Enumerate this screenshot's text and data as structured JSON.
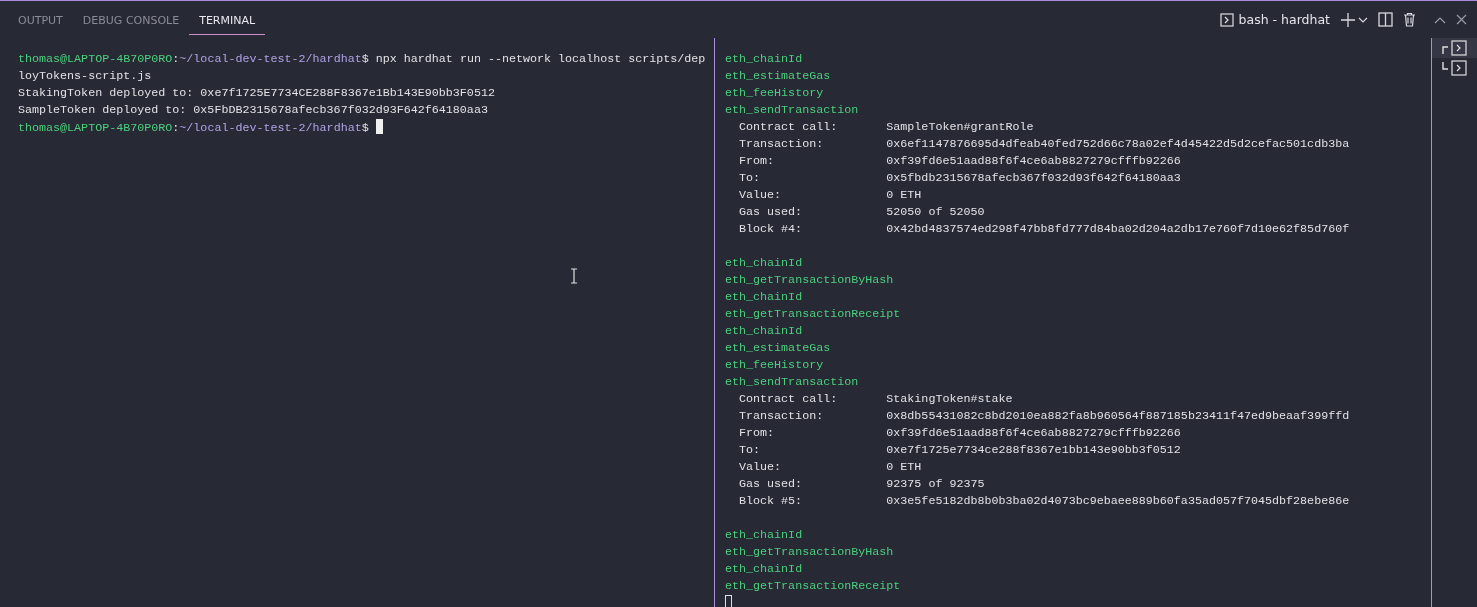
{
  "panel_tabs": [
    {
      "label": "OUTPUT",
      "selected": false
    },
    {
      "label": "DEBUG CONSOLE",
      "selected": false
    },
    {
      "label": "TERMINAL",
      "selected": true
    }
  ],
  "terminal_title": "bash - hardhat",
  "terminal_list": [
    {
      "selected": true
    },
    {
      "selected": false
    }
  ],
  "left_pane": {
    "prompts": [
      {
        "user": "thomas@LAPTOP-4B70P0RO",
        "separator": ":",
        "path": "~/local-dev-test-2/hardhat",
        "sigil": "$"
      },
      {
        "user": "thomas@LAPTOP-4B70P0RO",
        "separator": ":",
        "path": "~/local-dev-test-2/hardhat",
        "sigil": "$"
      }
    ],
    "command": "npx hardhat run --network localhost scripts/deployTokens-script.js",
    "output": [
      "StakingToken deployed to: 0xe7f1725E7734CE288F8367e1Bb143E90bb3F0512",
      "SampleToken deployed to: 0x5FbDB2315678afecb367f032d93F642f64180aa3"
    ],
    "cursor_focused": true
  },
  "right_pane": {
    "log": [
      {
        "kind": "method",
        "text": "eth_chainId"
      },
      {
        "kind": "method",
        "text": "eth_estimateGas"
      },
      {
        "kind": "method",
        "text": "eth_feeHistory"
      },
      {
        "kind": "method",
        "text": "eth_sendTransaction"
      },
      {
        "kind": "field",
        "label": "Contract call:",
        "value": "SampleToken#grantRole"
      },
      {
        "kind": "field",
        "label": "Transaction:",
        "value": "0x6ef1147876695d4dfeab40fed752d66c78a02ef4d45422d5d2cefac501cdb3ba"
      },
      {
        "kind": "field",
        "label": "From:",
        "value": "0xf39fd6e51aad88f6f4ce6ab8827279cfffb92266"
      },
      {
        "kind": "field",
        "label": "To:",
        "value": "0x5fbdb2315678afecb367f032d93f642f64180aa3"
      },
      {
        "kind": "field",
        "label": "Value:",
        "value": "0 ETH"
      },
      {
        "kind": "field",
        "label": "Gas used:",
        "value": "52050 of 52050"
      },
      {
        "kind": "field",
        "label": "Block #4:",
        "value": "0x42bd4837574ed298f47bb8fd777d84ba02d204a2db17e760f7d10e62f85d760f"
      },
      {
        "kind": "gap"
      },
      {
        "kind": "method",
        "text": "eth_chainId"
      },
      {
        "kind": "method",
        "text": "eth_getTransactionByHash"
      },
      {
        "kind": "method",
        "text": "eth_chainId"
      },
      {
        "kind": "method",
        "text": "eth_getTransactionReceipt"
      },
      {
        "kind": "method",
        "text": "eth_chainId"
      },
      {
        "kind": "method",
        "text": "eth_estimateGas"
      },
      {
        "kind": "method",
        "text": "eth_feeHistory"
      },
      {
        "kind": "method",
        "text": "eth_sendTransaction"
      },
      {
        "kind": "field",
        "label": "Contract call:",
        "value": "StakingToken#stake"
      },
      {
        "kind": "field",
        "label": "Transaction:",
        "value": "0x8db55431082c8bd2010ea882fa8b960564f887185b23411f47ed9beaaf399ffd"
      },
      {
        "kind": "field",
        "label": "From:",
        "value": "0xf39fd6e51aad88f6f4ce6ab8827279cfffb92266"
      },
      {
        "kind": "field",
        "label": "To:",
        "value": "0xe7f1725e7734ce288f8367e1bb143e90bb3f0512"
      },
      {
        "kind": "field",
        "label": "Value:",
        "value": "0 ETH"
      },
      {
        "kind": "field",
        "label": "Gas used:",
        "value": "92375 of 92375"
      },
      {
        "kind": "field",
        "label": "Block #5:",
        "value": "0x3e5fe5182db8b0b3ba02d4073bc9ebaee889b60fa35ad057f7045dbf28ebe86e"
      },
      {
        "kind": "gap"
      },
      {
        "kind": "method",
        "text": "eth_chainId"
      },
      {
        "kind": "method",
        "text": "eth_getTransactionByHash"
      },
      {
        "kind": "method",
        "text": "eth_chainId"
      },
      {
        "kind": "method",
        "text": "eth_getTransactionReceipt"
      }
    ],
    "cursor_focused": false
  }
}
